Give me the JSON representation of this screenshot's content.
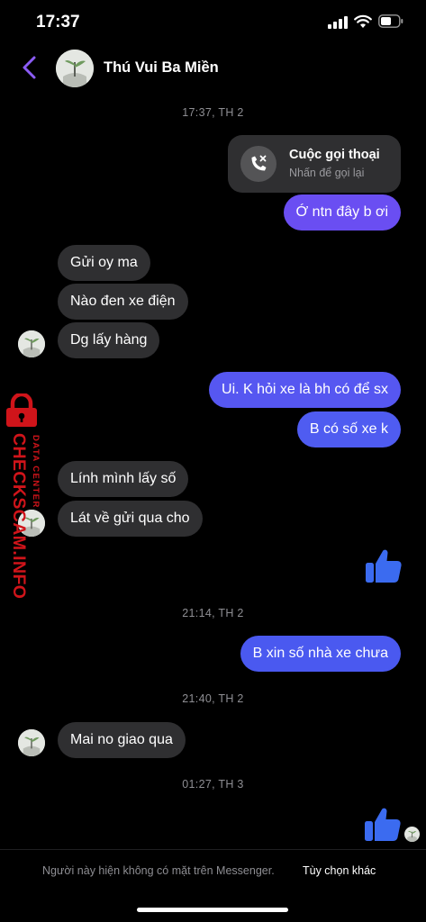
{
  "status_bar": {
    "time": "17:37"
  },
  "header": {
    "title": "Thú Vui Ba Miền"
  },
  "call_card": {
    "title": "Cuộc gọi thoại",
    "subtitle": "Nhấn để gọi lại"
  },
  "timestamps": [
    "17:37, TH 2",
    "21:14, TH 2",
    "21:40, TH 2",
    "01:27, TH 3"
  ],
  "messages": [
    {
      "from": "me",
      "text": "Ớ ntn đây b ơi"
    },
    {
      "from": "them",
      "text": "Gửi oy ma"
    },
    {
      "from": "them",
      "text": "Nào đen xe điện"
    },
    {
      "from": "them",
      "text": "Dg lấy hàng"
    },
    {
      "from": "me",
      "text": "Ui. K hỏi xe là bh có để sx"
    },
    {
      "from": "me",
      "text": "B có số xe k"
    },
    {
      "from": "them",
      "text": "Lính mình lấy số"
    },
    {
      "from": "them",
      "text": "Lát về gửi qua cho"
    },
    {
      "from": "me",
      "text": "B xin số nhà xe chưa"
    },
    {
      "from": "them",
      "text": "Mai no giao qua"
    }
  ],
  "watermark": {
    "line1": "DATA CENTER",
    "line2": "CHECKSCAM.INFO"
  },
  "footer": {
    "note": "Người này hiện không có mặt trên Messenger.",
    "action": "Tùy chọn khác"
  },
  "colors": {
    "accent": "#8b5cf6",
    "bubble_out_top": "#7b4cf4",
    "bubble_out_bottom": "#4a59f0",
    "bubble_in": "#2f2f31",
    "like_blue": "#3b6bf0"
  },
  "icons": [
    "back-chevron-icon",
    "missed-call-icon",
    "thumbs-up-icon",
    "lock-icon"
  ]
}
